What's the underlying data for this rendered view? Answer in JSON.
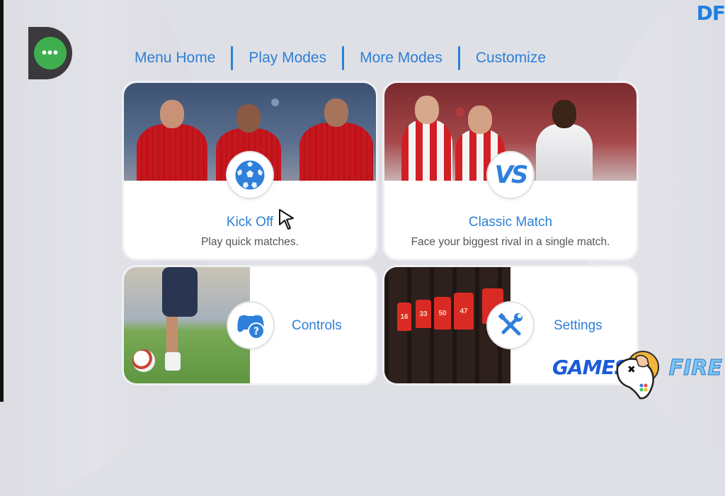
{
  "nav": {
    "items": [
      {
        "label": "Menu Home"
      },
      {
        "label": "Play Modes"
      },
      {
        "label": "More Modes"
      },
      {
        "label": "Customize"
      }
    ]
  },
  "header": {
    "menu_button_glyph": "•••",
    "corner_text": "DF"
  },
  "cards": {
    "kick_off": {
      "title": "Kick Off",
      "description": "Play quick matches.",
      "icon": "soccer-ball-icon"
    },
    "classic_match": {
      "title": "Classic Match",
      "description": "Face your biggest rival in a single match.",
      "icon": "versus-icon",
      "icon_text": "VS"
    },
    "controls": {
      "title": "Controls",
      "icon": "gamepad-help-icon",
      "icon_text": "?"
    },
    "settings": {
      "title": "Settings",
      "icon": "tools-icon",
      "jersey_numbers": [
        "16",
        "33",
        "50",
        "47"
      ]
    }
  },
  "watermark": {
    "left_text": "GAMES",
    "right_text": "FIRE"
  },
  "colors": {
    "accent_blue": "#2e7fd6",
    "menu_green": "#3fae4f",
    "background": "#dfe0e6"
  }
}
